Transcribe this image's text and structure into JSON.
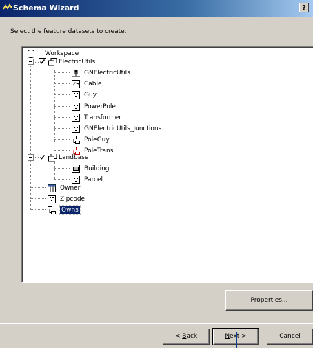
{
  "window": {
    "title": "Schema Wizard",
    "help_label": "?"
  },
  "instruction": "Select the feature datasets to create.",
  "tree": {
    "workspace": "Workspace",
    "electric_utils": {
      "label": "ElectricUtils",
      "checked": true,
      "children": [
        "GNElectricUtils",
        "Cable",
        "Guy",
        "PowerPole",
        "Transformer",
        "GNElectricUtils_Junctions",
        "PoleGuy",
        "PoleTrans"
      ]
    },
    "landbase": {
      "label": "Landbase",
      "checked": true,
      "children": [
        "Building",
        "Parcel"
      ]
    },
    "top_level": [
      "Owner",
      "Zipcode",
      "Owns"
    ],
    "selected_item": "Owns"
  },
  "buttons": {
    "properties": "Properties...",
    "back_prefix": "< ",
    "back_mnemonic": "B",
    "back_rest": "ack",
    "next_mnemonic": "N",
    "next_rest": "ext >",
    "cancel": "Cancel"
  },
  "colors": {
    "titlebar": "#0a246a",
    "selection": "#0a246a",
    "face": "#d4d0c8"
  }
}
